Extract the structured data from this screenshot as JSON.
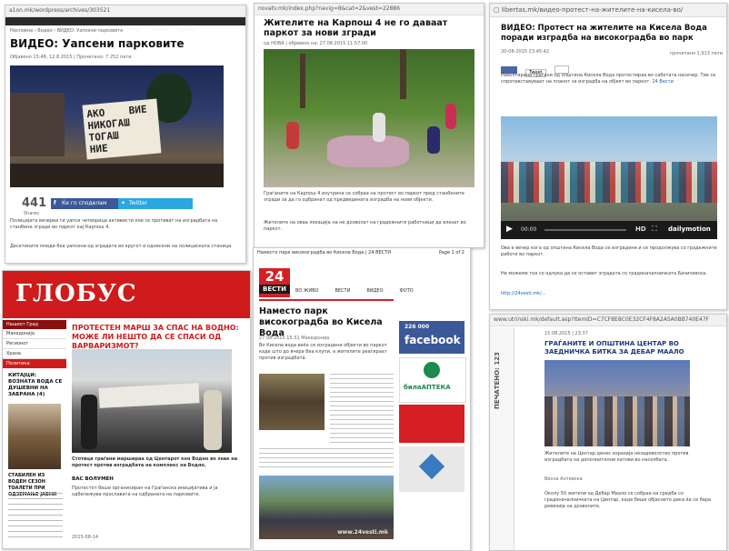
{
  "card1": {
    "url": "a1on.mk/wordpress/archives/303521",
    "nav": [
      "Македонија",
      "Економија",
      "Регион",
      "Свет",
      "Спорт",
      "Забава",
      "Здравје",
      "Магазин"
    ],
    "breadcrumb": "Насловна › Видео › ВИДЕО: Уапсени парковите",
    "title": "ВИДЕО: Уапсени парковите",
    "meta": "Објавено 15:48, 12.8.2015 | Прочитано: 7 252 пати",
    "sign_text": "АКО ВИЕ НИКОГАШ ТОГАШ НИЕ",
    "share_count": "441",
    "share_label": "Shares",
    "fb_label": "Ќе го споделам",
    "tw_label": "Twitter",
    "para1": "Полицијата вечерва ги уапси четворица активисти кои се противат на изградбата на станбени згради во паркот кај Карпош 4.",
    "para2": "Десетините млади беа уапсени од зградата во кругот и однесени на полициската станица."
  },
  "card2": {
    "url": "novatv.mk/index.php?navig=8&cat=2&vest=22886",
    "title": "Жителите на Карпош 4 не го даваат паркот за нови згради",
    "meta": "од НОВА | објавено на: 27.08.2015 11:57:00",
    "para1": "Граѓаните на Карпош 4 изутрина се собраа на протест во паркот пред станбените згради за да го одбранат од предвидената изградба на нови објекти.",
    "para2": "Жителите на оваа локација на не дозволат на градежните работници да влезат во паркот."
  },
  "card3": {
    "url": "libertas.mk/видео-протест-на-жителите-на-кисела-во/",
    "title": "ВИДЕО: Протест на жителите на Кисела Вода поради изградба на високоградба во парк",
    "date": "20-08-2015 23:45:42",
    "views": "прочитано 1,913 пати",
    "tweet_label": "Tweet",
    "para1": "Револтирани граѓани од општина Кисела Вода протестираа во саботата насечер. Тие се спротивставуваат на планот за изградба на објект во паркот.",
    "link_text": "24 Вести",
    "video_time": "00:00",
    "video_brand": "dailymotion",
    "para2": "Ова е вечер кога од општина Кисела Вода се изградени и се продолжува со градежните работи во паркот.",
    "para3": "Не можеме тоа со одлука да се оставит зградата со градоначалничката Бачичевска.",
    "link2": "http://24vesti.mk/..."
  },
  "card4": {
    "logo": "ГЛОБУС",
    "headline": "ПРОТЕСТЕН МАРШ ЗА СПАС НА ВОДНО: МОЖЕ ЛИ НЕШТО ДА СЕ СПАСИ ОД ВАРВАРИЗМОТ?",
    "menu": [
      "Нашиот Град",
      "Македонија",
      "Регионот",
      "Храна",
      "Политика"
    ],
    "side_title": "КИТАЈЦИ: ВОЗНАТА ВОДА СЕ ДУШЕВНИ НА ЗАБРАНА (4)",
    "side_extra": "СТАБИЛЕН ИЗ ВОДЕН СЕЗОН ТОАЛЕТИ ПРИ ОДЗЕМАЊЕ ЈАВНИ",
    "section": "ВАС ВОЛУМЕН",
    "caption": "Стотици граѓани маршираа од Центарот кон Водно во знак на протест против изградбата на комплекс на Водно.",
    "body": "Протестот беше организиран на Граѓанска иницијатива и ја одбележува прославата на одбраната на парковите.",
    "date": "2015-08-14"
  },
  "card5": {
    "header": "Наместо парк високоградба во Кисела Вода | 24 ВЕСТИ",
    "page": "Page 1 of 2",
    "tabs": [
      "ВО ЖИВО",
      "ВЕСТИ",
      "ВИДЕО",
      "ФОТО"
    ],
    "logo_num": "24",
    "logo_word": "ВЕСТИ",
    "title": "Наместо парк високоградба во Кисела Вода",
    "meta": "27.08.2015 15:31 Македонија",
    "body": "Во Кисела вода веќе се изградени објекти во паркот каде што до вчера беа клупи, а жителите реагираат против изградбата.",
    "ad_fb_count": "226 000",
    "ad_fb": "facebook",
    "ad_pharma": "билаАПТЕКА",
    "watermark": "www.24vesti.mk"
  },
  "card6": {
    "url": "www.utrinski.mk/default.asp?ItemID=C7CF8E8C0E32CF4F8A2A5A0BB740E47F",
    "date": "15.08.2015 | 23:37",
    "side_text": "ПЕЧАТЕНО: 123",
    "title": "ГРАЃАНИТЕ И ОПШТИНА ЦЕНТАР ВО ЗАЕДНИЧКА БИТКА ЗА ДЕБАР МААЛО",
    "caption": "Жителите на Центар денес изразија незадоволство против изградбата на дополнителни катови во населбата.",
    "author": "Весна Антевска",
    "body": "Околу 50 жители од Дебар Маало се собраа на средба со градоначалничката на Центар, каде беше објаснето дека ќе се бара ревизија на дозволите."
  }
}
